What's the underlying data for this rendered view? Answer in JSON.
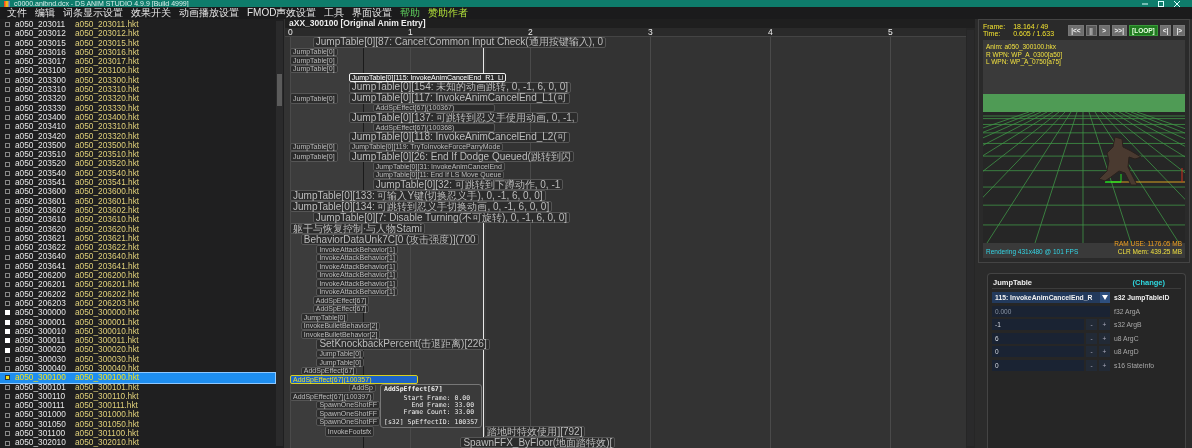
{
  "window": {
    "title": "c0000.anibnd.dcx - DS ANIM STUDIO 4.9.9 [Build 4999]"
  },
  "menu": [
    {
      "label": "文件",
      "kind": "normal"
    },
    {
      "label": "编辑",
      "kind": "normal"
    },
    {
      "label": "词条显示设置",
      "kind": "normal"
    },
    {
      "label": "效果开关",
      "kind": "normal"
    },
    {
      "label": "动画播放设置",
      "kind": "normal"
    },
    {
      "label": "FMOD声效设置",
      "kind": "normal"
    },
    {
      "label": "工具",
      "kind": "normal"
    },
    {
      "label": "界面设置",
      "kind": "normal"
    },
    {
      "label": "帮助",
      "kind": "help"
    },
    {
      "label": "赞助作者",
      "kind": "sponsor"
    }
  ],
  "anim_list": {
    "rows": [
      {
        "name": "a050_203011",
        "file": "a050_203011.hkt",
        "loaded": false,
        "selected": false
      },
      {
        "name": "a050_203012",
        "file": "a050_203012.hkt",
        "loaded": false,
        "selected": false
      },
      {
        "name": "a050_203015",
        "file": "a050_203015.hkt",
        "loaded": false,
        "selected": false
      },
      {
        "name": "a050_203016",
        "file": "a050_203016.hkt",
        "loaded": false,
        "selected": false
      },
      {
        "name": "a050_203017",
        "file": "a050_203017.hkt",
        "loaded": false,
        "selected": false
      },
      {
        "name": "a050_203100",
        "file": "a050_203100.hkt",
        "loaded": false,
        "selected": false
      },
      {
        "name": "a050_203300",
        "file": "a050_203300.hkt",
        "loaded": false,
        "selected": false
      },
      {
        "name": "a050_203310",
        "file": "a050_203310.hkt",
        "loaded": false,
        "selected": false
      },
      {
        "name": "a050_203320",
        "file": "a050_203320.hkt",
        "loaded": false,
        "selected": false
      },
      {
        "name": "a050_203330",
        "file": "a050_203330.hkt",
        "loaded": false,
        "selected": false
      },
      {
        "name": "a050_203400",
        "file": "a050_203400.hkt",
        "loaded": false,
        "selected": false
      },
      {
        "name": "a050_203410",
        "file": "a050_203310.hkt",
        "loaded": false,
        "selected": false
      },
      {
        "name": "a050_203420",
        "file": "a050_203320.hkt",
        "loaded": false,
        "selected": false
      },
      {
        "name": "a050_203500",
        "file": "a050_203500.hkt",
        "loaded": false,
        "selected": false
      },
      {
        "name": "a050_203510",
        "file": "a050_203510.hkt",
        "loaded": false,
        "selected": false
      },
      {
        "name": "a050_203520",
        "file": "a050_203520.hkt",
        "loaded": false,
        "selected": false
      },
      {
        "name": "a050_203540",
        "file": "a050_203540.hkt",
        "loaded": false,
        "selected": false
      },
      {
        "name": "a050_203541",
        "file": "a050_203541.hkt",
        "loaded": false,
        "selected": false
      },
      {
        "name": "a050_203600",
        "file": "a050_203600.hkt",
        "loaded": false,
        "selected": false
      },
      {
        "name": "a050_203601",
        "file": "a050_203601.hkt",
        "loaded": false,
        "selected": false
      },
      {
        "name": "a050_203602",
        "file": "a050_203602.hkt",
        "loaded": false,
        "selected": false
      },
      {
        "name": "a050_203610",
        "file": "a050_203610.hkt",
        "loaded": false,
        "selected": false
      },
      {
        "name": "a050_203620",
        "file": "a050_203620.hkt",
        "loaded": false,
        "selected": false
      },
      {
        "name": "a050_203621",
        "file": "a050_203621.hkt",
        "loaded": false,
        "selected": false
      },
      {
        "name": "a050_203622",
        "file": "a050_203622.hkt",
        "loaded": false,
        "selected": false
      },
      {
        "name": "a050_203640",
        "file": "a050_203640.hkt",
        "loaded": false,
        "selected": false
      },
      {
        "name": "a050_203641",
        "file": "a050_203641.hkt",
        "loaded": false,
        "selected": false
      },
      {
        "name": "a050_206200",
        "file": "a050_206200.hkt",
        "loaded": false,
        "selected": false
      },
      {
        "name": "a050_206201",
        "file": "a050_206201.hkt",
        "loaded": false,
        "selected": false
      },
      {
        "name": "a050_206202",
        "file": "a050_206202.hkt",
        "loaded": false,
        "selected": false
      },
      {
        "name": "a050_206203",
        "file": "a050_206203.hkt",
        "loaded": false,
        "selected": false
      },
      {
        "name": "a050_300000",
        "file": "a050_300000.hkt",
        "loaded": true,
        "selected": false
      },
      {
        "name": "a050_300001",
        "file": "a050_300001.hkt",
        "loaded": true,
        "selected": false
      },
      {
        "name": "a050_300010",
        "file": "a050_300010.hkt",
        "loaded": true,
        "selected": false
      },
      {
        "name": "a050_300011",
        "file": "a050_300011.hkt",
        "loaded": true,
        "selected": false
      },
      {
        "name": "a050_300020",
        "file": "a050_300020.hkt",
        "loaded": true,
        "selected": false
      },
      {
        "name": "a050_300030",
        "file": "a050_300030.hkt",
        "loaded": false,
        "selected": false
      },
      {
        "name": "a050_300040",
        "file": "a050_300040.hkt",
        "loaded": false,
        "selected": false
      },
      {
        "name": "a050_300100",
        "file": "a050_300100.hkt",
        "loaded": true,
        "selected": true
      },
      {
        "name": "a050_300101",
        "file": "a050_300101.hkt",
        "loaded": false,
        "selected": false
      },
      {
        "name": "a050_300110",
        "file": "a050_300110.hkt",
        "loaded": false,
        "selected": false
      },
      {
        "name": "a050_300111",
        "file": "a050_300111.hkt",
        "loaded": false,
        "selected": false
      },
      {
        "name": "a050_301000",
        "file": "a050_301000.hkt",
        "loaded": false,
        "selected": false
      },
      {
        "name": "a050_301050",
        "file": "a050_301050.hkt",
        "loaded": false,
        "selected": false
      },
      {
        "name": "a050_301100",
        "file": "a050_301100.hkt",
        "loaded": false,
        "selected": false
      },
      {
        "name": "a050_302010",
        "file": "a050_302010.hkt",
        "loaded": false,
        "selected": false
      }
    ]
  },
  "timeline": {
    "title": "aXX_300100 [Original Anim Entry]",
    "ticks": [
      "0",
      "1",
      "2",
      "3",
      "4",
      "5"
    ],
    "rows": [
      {
        "events": [
          {
            "label": "JumpTable[0][87: Cancel:Common Input Check(通用按键输入), 0",
            "selected": false,
            "hovered": false
          }
        ]
      },
      {
        "events": [
          {
            "label": "JumpTable[0]",
            "selected": false,
            "hovered": false
          }
        ]
      },
      {
        "events": [
          {
            "label": "JumpTable[0]",
            "selected": false,
            "hovered": false
          }
        ]
      },
      {
        "events": [
          {
            "label": "JumpTable[0]",
            "selected": false,
            "hovered": false
          }
        ]
      },
      {
        "events": [
          {
            "label": "JumpTable[0][115: InvokeAnimCancelEnd_R1_Li",
            "selected": true,
            "hovered": false
          }
        ]
      },
      {
        "events": [
          {
            "label": "JumpTable[0][154: 未知的动画跳转, 0, -1, 6, 0, 0]",
            "selected": false,
            "hovered": false
          }
        ]
      },
      {
        "events": [
          {
            "label": "JumpTable[0]",
            "selected": false,
            "hovered": false
          },
          {
            "label": "JumpTable[0][117: InvokeAnimCancelEnd_L1(可",
            "selected": false,
            "hovered": false
          }
        ]
      },
      {
        "events": [
          {
            "label": "AddSpEffect[67](100367)",
            "selected": false,
            "hovered": false
          }
        ]
      },
      {
        "events": [
          {
            "label": "JumpTable[0][137: 可跳转到忍义手使用动画, 0, -1,",
            "selected": false,
            "hovered": false
          }
        ]
      },
      {
        "events": [
          {
            "label": "AddSpEffect[67](100368)",
            "selected": false,
            "hovered": false
          }
        ]
      },
      {
        "events": [
          {
            "label": "JumpTable[0][118: InvokeAnimCancelEnd_L2(可",
            "selected": false,
            "hovered": false
          }
        ]
      },
      {
        "events": [
          {
            "label": "JumpTable[0]",
            "selected": false,
            "hovered": false
          },
          {
            "label": "JumpTable[0][119: TryToInvokeForceParryMode",
            "selected": false,
            "hovered": false
          }
        ]
      },
      {
        "events": [
          {
            "label": "JumpTable[0]",
            "selected": false,
            "hovered": false
          },
          {
            "label": "JumpTable[0][26: End If Dodge Queued(跳转到闪",
            "selected": false,
            "hovered": false
          }
        ]
      },
      {
        "events": [
          {
            "label": "JumpTable[0][31: InvokeAnimCancelEnd",
            "selected": false,
            "hovered": false
          }
        ]
      },
      {
        "events": [
          {
            "label": "JumpTable[0][11: End If LS Move Queue",
            "selected": false,
            "hovered": false
          }
        ]
      },
      {
        "events": [
          {
            "label": "JumpTable[0][32: 可跳转到下蹲动作, 0, -1",
            "selected": false,
            "hovered": false
          }
        ]
      },
      {
        "events": [
          {
            "label": "JumpTable[0][133: 可输入Y键(切换忍义手), 0, -1, 6, 0, 0]",
            "selected": false,
            "hovered": false
          }
        ]
      },
      {
        "events": [
          {
            "label": "JumpTable[0][134: 可跳转到忍义手切换动画, 0, -1, 6, 0, 0]",
            "selected": false,
            "hovered": false
          }
        ]
      },
      {
        "events": [
          {
            "label": "JumpTable[0][7: Disable Turning(不可旋转), 0, -1, 6, 0, 0]",
            "selected": false,
            "hovered": false
          }
        ]
      },
      {
        "events": [
          {
            "label": "躯干与恢复控制·与人物Stami",
            "selected": false,
            "hovered": false
          }
        ]
      },
      {
        "events": [
          {
            "label": "BehaviorDataUnk7C[0 (攻击强度)](700",
            "selected": false,
            "hovered": false
          }
        ]
      },
      {
        "events": [
          {
            "label": "InvokeAttackBehavior[1]",
            "selected": false,
            "hovered": false
          }
        ]
      },
      {
        "events": [
          {
            "label": "InvokeAttackBehavior[1]",
            "selected": false,
            "hovered": false
          }
        ]
      },
      {
        "events": [
          {
            "label": "InvokeAttackBehavior[1]",
            "selected": false,
            "hovered": false
          }
        ]
      },
      {
        "events": [
          {
            "label": "InvokeAttackBehavior[1]",
            "selected": false,
            "hovered": false
          }
        ]
      },
      {
        "events": [
          {
            "label": "InvokeAttackBehavior[1]",
            "selected": false,
            "hovered": false
          }
        ]
      },
      {
        "events": [
          {
            "label": "InvokeAttackBehavior[1]",
            "selected": false,
            "hovered": false
          }
        ]
      },
      {
        "events": [
          {
            "label": "AddSpEffect[67]",
            "selected": false,
            "hovered": false
          }
        ]
      },
      {
        "events": [
          {
            "label": "AddSpEffect[67]",
            "selected": false,
            "hovered": false
          }
        ]
      },
      {
        "events": [
          {
            "label": "JumpTable[0]",
            "selected": false,
            "hovered": false
          }
        ]
      },
      {
        "events": [
          {
            "label": "InvokeBulletBehavior[2]",
            "selected": false,
            "hovered": false
          }
        ]
      },
      {
        "events": [
          {
            "label": "InvokeBulletBehavior[2]",
            "selected": false,
            "hovered": false
          }
        ]
      },
      {
        "events": [
          {
            "label": "SetKnockbackPercent(击退距离)[226]",
            "selected": false,
            "hovered": false
          }
        ]
      },
      {
        "events": [
          {
            "label": "JumpTable[0]",
            "selected": false,
            "hovered": false
          }
        ]
      },
      {
        "events": [
          {
            "label": "JumpTable[0]",
            "selected": false,
            "hovered": false
          }
        ]
      },
      {
        "events": [
          {
            "label": "AddSpEffect[67]",
            "selected": false,
            "hovered": false
          }
        ]
      },
      {
        "events": [
          {
            "label": "AddSpEffect[67](100357)",
            "selected": false,
            "hovered": true
          }
        ]
      },
      {
        "events": [
          {
            "label": "AddSp",
            "selected": false,
            "hovered": false
          }
        ]
      },
      {
        "events": [
          {
            "label": "AddSpEffect[67](100397)",
            "selected": false,
            "hovered": false
          }
        ]
      },
      {
        "events": [
          {
            "label": "SpawnOneShotFF",
            "selected": false,
            "hovered": false
          }
        ]
      },
      {
        "events": [
          {
            "label": "SpawnOneShotFF",
            "selected": false,
            "hovered": false
          }
        ]
      },
      {
        "events": [
          {
            "label": "SpawnOneShotFF",
            "selected": false,
            "hovered": false
          }
        ]
      },
      {
        "events": [
          {
            "label": "InvokeFootsfx",
            "selected": false,
            "hovered": false
          },
          {
            "label": "踏地时特效使用][792]",
            "selected": false,
            "hovered": false
          }
        ]
      },
      {
        "events": [
          {
            "label": "SpawnFFX_ByFloor(地面踏特效)[",
            "selected": false,
            "hovered": false
          }
        ]
      }
    ],
    "tooltip": {
      "title": "AddSpEffect[67]",
      "lines": [
        {
          "label": "Start Frame:",
          "value": "0.00"
        },
        {
          "label": "End Frame:",
          "value": "33.00"
        },
        {
          "label": "Frame Count:",
          "value": "33.00"
        },
        {
          "label": "[s32] SpEffectID:",
          "value": "100357"
        }
      ]
    }
  },
  "viewer": {
    "frame_label": "Frame:",
    "frame": "18.164 / 49",
    "time_label": "Time:",
    "time": "0.605 / 1.633",
    "buttons": [
      {
        "label": "|<<",
        "kind": "normal"
      },
      {
        "label": "||",
        "kind": "dim"
      },
      {
        "label": ">",
        "kind": "normal"
      },
      {
        "label": ">>|",
        "kind": "normal"
      },
      {
        "label": "[LOOP]",
        "kind": "toggle",
        "on": true
      },
      {
        "label": "<|",
        "kind": "normal"
      },
      {
        "label": "|>",
        "kind": "normal"
      }
    ],
    "info": [
      "Anim: a050_300100.hkx",
      "R WPN: WP_A_0300[a50]",
      "L WPN: WP_A_0750[a75]"
    ],
    "rendering": "Rendering 431x480 @ 101 FPS",
    "ram": "RAM USE: 1176.05 MB",
    "clr": "CLR Mem: 439.25 MB"
  },
  "inspector": {
    "title": "JumpTable",
    "change": "(Change)",
    "fields": [
      {
        "kind": "dropdown",
        "value": "115: InvokeAnimCancelEnd_R",
        "label": "s32 JumpTableID"
      },
      {
        "kind": "plain",
        "value": "0.000",
        "label": "f32 ArgA"
      },
      {
        "kind": "stepper",
        "value": "-1",
        "label": "s32 ArgB",
        "minus": "-",
        "plus": "+"
      },
      {
        "kind": "stepper",
        "value": "6",
        "label": "u8 ArgC",
        "minus": "-",
        "plus": "+"
      },
      {
        "kind": "stepper",
        "value": "0",
        "label": "u8 ArgD",
        "minus": "-",
        "plus": "+"
      },
      {
        "kind": "stepper",
        "value": "0",
        "label": "s16 StateInfo",
        "minus": "-",
        "plus": "+"
      }
    ]
  }
}
